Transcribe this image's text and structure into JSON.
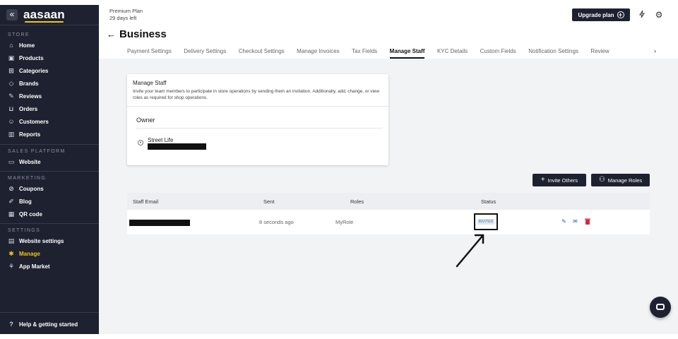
{
  "sidebar": {
    "logo": "aasaan",
    "collapse_icon": "«",
    "sections": {
      "store": "STORE",
      "sales_platform": "SALES PLATFORM",
      "marketing": "MARKETING",
      "settings": "SETTINGS"
    },
    "items": {
      "home": "Home",
      "products": "Products",
      "categories": "Categories",
      "brands": "Brands",
      "reviews": "Reviews",
      "orders": "Orders",
      "customers": "Customers",
      "reports": "Reports",
      "website": "Website",
      "coupons": "Coupons",
      "blog": "Blog",
      "qr_code": "QR code",
      "website_settings": "Website settings",
      "manage": "Manage",
      "app_market": "App Market"
    },
    "help": "Help & getting started",
    "active_color": "#f3c316",
    "bg_color": "#1e2230"
  },
  "topbar": {
    "plan_name": "Premium Plan",
    "days_left": "29 days left",
    "upgrade_label": "Upgrade plan",
    "page_title": "Business"
  },
  "tabs": [
    "Payment Settings",
    "Delivery Settings",
    "Checkout Settings",
    "Manage Invoices",
    "Tax Fields",
    "Manage Staff",
    "KYC Details",
    "Custom Fields",
    "Notification Settings",
    "Review"
  ],
  "active_tab": "Manage Staff",
  "manage_staff": {
    "title": "Manage Staff",
    "description": "Invite your team members to participate in store operations by sending them an invitation. Additionally, add, change, or view roles as required for shop operations.",
    "owner_heading": "Owner",
    "owner_name": "Street Life"
  },
  "buttons": {
    "invite_others": "Invite Others",
    "manage_roles": "Manage Roles"
  },
  "table": {
    "headers": {
      "email": "Staff Email",
      "sent": "Sent",
      "roles": "Roles",
      "status": "Status"
    },
    "rows": [
      {
        "sent": "8 seconds ago",
        "role": "MyRole",
        "status": "INVITED"
      }
    ]
  }
}
